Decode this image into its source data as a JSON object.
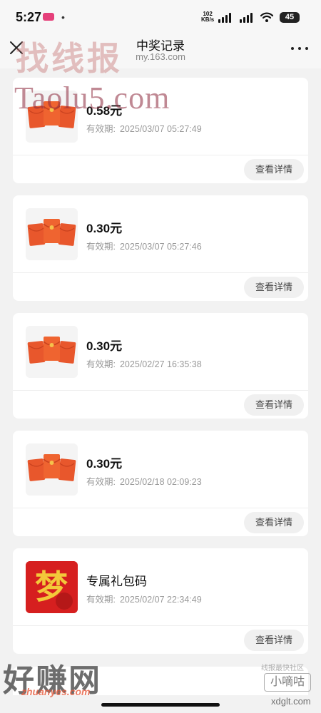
{
  "status_bar": {
    "time": "5:27",
    "dot": "•",
    "net_speed": "102",
    "net_unit": "KB/s",
    "battery": "45"
  },
  "header": {
    "title": "中奖记录",
    "subtitle": "my.163.com",
    "close_icon": "close-icon",
    "more_icon": "more-icon"
  },
  "records": [
    {
      "amount": "0.58元",
      "validity_label": "有效期:",
      "validity": "2025/03/07 05:27:49",
      "thumb": "red-envelope",
      "button": "查看详情"
    },
    {
      "amount": "0.30元",
      "validity_label": "有效期:",
      "validity": "2025/03/07 05:27:46",
      "thumb": "red-envelope",
      "button": "查看详情"
    },
    {
      "amount": "0.30元",
      "validity_label": "有效期:",
      "validity": "2025/02/27 16:35:38",
      "thumb": "red-envelope",
      "button": "查看详情"
    },
    {
      "amount": "0.30元",
      "validity_label": "有效期:",
      "validity": "2025/02/18 02:09:23",
      "thumb": "red-envelope",
      "button": "查看详情"
    },
    {
      "amount": "专属礼包码",
      "validity_label": "有效期:",
      "validity": "2025/02/07 22:34:49",
      "thumb": "game-logo",
      "logo_glyph": "梦",
      "button": "查看详情"
    }
  ],
  "watermarks": {
    "top": "找线报",
    "taolu": "Taolu5.com",
    "haozhuan": "好赚网",
    "haozhuan_url": "zhuanyes.com",
    "community": "线报最快社区",
    "xiaodigu": "小嘀咕",
    "xdglt": "xdglt.com"
  },
  "colors": {
    "envelope": "#e8572c",
    "envelope_dark": "#c9421f",
    "logo_bg": "#d61f1f",
    "logo_glyph": "#f3c93a"
  }
}
